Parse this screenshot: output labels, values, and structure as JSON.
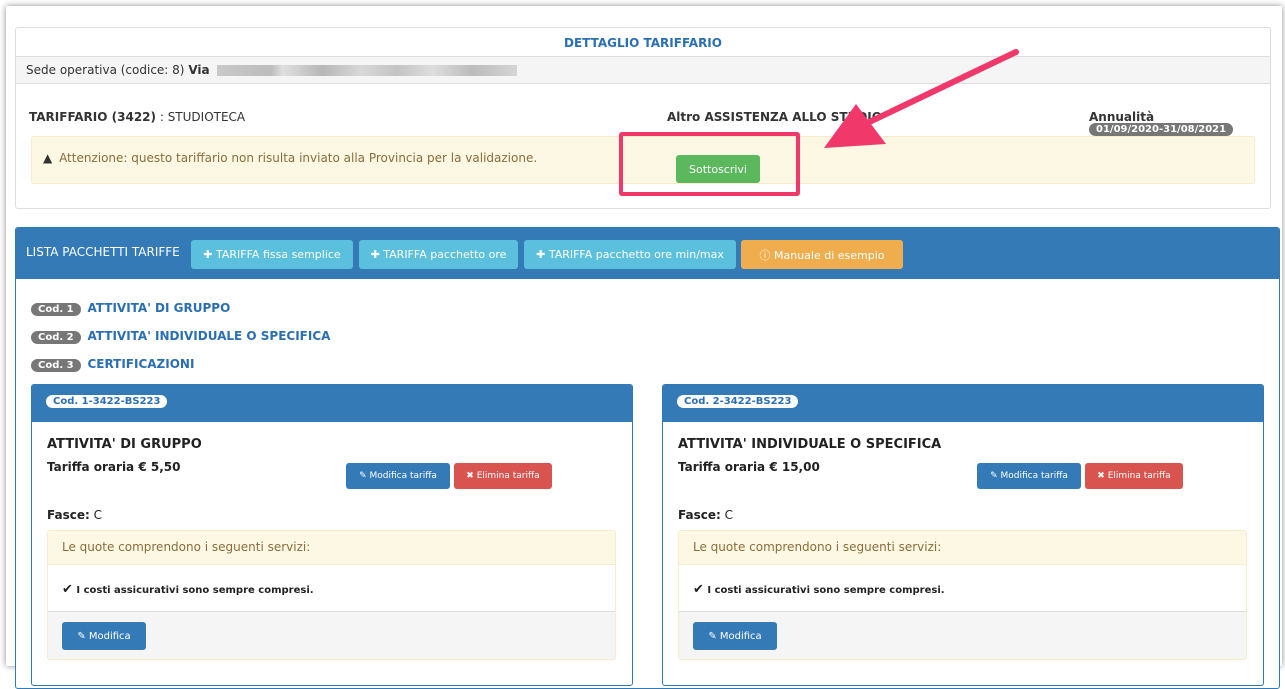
{
  "header": {
    "title": "DETTAGLIO TARIFFARIO",
    "sede_prefix": "Sede operativa (codice: 8)",
    "sede_via": "Via",
    "tariffario_label": "TARIFFARIO (3422)",
    "tariffario_sep": " : ",
    "tariffario_name": "STUDIOTECA",
    "categoria": "Altro ASSISTENZA ALLO STUDIO",
    "annualita_label": "Annualità",
    "annualita_value": "01/09/2020-31/08/2021",
    "warning_text": "Attenzione: questo tariffario non risulta inviato alla Provincia per la validazione.",
    "sottoscrivi_label": "Sottoscrivi"
  },
  "lista": {
    "title": "LISTA PACCHETTI TARIFFE",
    "buttons": [
      {
        "label": "TARIFFA fissa semplice",
        "icon": "plus-icon"
      },
      {
        "label": "TARIFFA pacchetto ore",
        "icon": "plus-icon"
      },
      {
        "label": "TARIFFA pacchetto ore min/max",
        "icon": "plus-icon"
      },
      {
        "label": "Manuale di esempio",
        "icon": "info-circle-icon"
      }
    ],
    "codes": [
      {
        "badge": "Cod. 1",
        "label": "ATTIVITA' DI GRUPPO"
      },
      {
        "badge": "Cod. 2",
        "label": "ATTIVITA' INDIVIDUALE O SPECIFICA"
      },
      {
        "badge": "Cod. 3",
        "label": "CERTIFICAZIONI"
      }
    ]
  },
  "cards": [
    {
      "code": "Cod. 1-3422-BS223",
      "title": "ATTIVITA' DI GRUPPO",
      "rate": "Tariffa oraria € 5,50",
      "modifica_tariffa": "Modifica tariffa",
      "elimina_tariffa": "Elimina tariffa",
      "fasce_label": "Fasce:",
      "fasce_value": "C",
      "services_header": "Le quote comprendono i seguenti servizi:",
      "service_item": "I costi assicurativi sono sempre compresi.",
      "modifica": "Modifica"
    },
    {
      "code": "Cod. 2-3422-BS223",
      "title": "ATTIVITA' INDIVIDUALE O SPECIFICA",
      "rate": "Tariffa oraria € 15,00",
      "modifica_tariffa": "Modifica tariffa",
      "elimina_tariffa": "Elimina tariffa",
      "fasce_label": "Fasce:",
      "fasce_value": "C",
      "services_header": "Le quote comprendono i seguenti servizi:",
      "service_item": "I costi assicurativi sono sempre compresi.",
      "modifica": "Modifica"
    }
  ],
  "colors": {
    "primary": "#337ab7",
    "success": "#5cb85c",
    "danger": "#d9534f",
    "info": "#5bc0de",
    "warning": "#f0ad4e",
    "annotation": "#f0386b"
  }
}
